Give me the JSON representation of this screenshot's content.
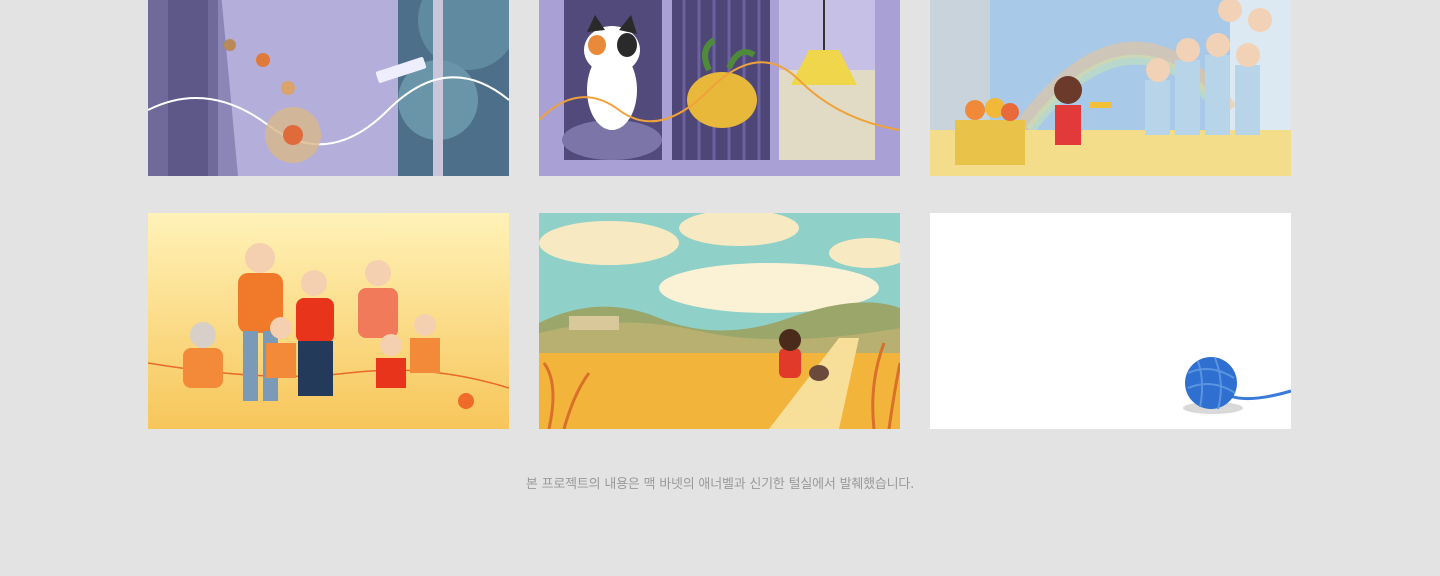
{
  "gallery": {
    "cards": [
      {
        "name": "illustration-town-street",
        "scene": "bird's-eye street with children and yarn line"
      },
      {
        "name": "illustration-cat-window",
        "scene": "calico cat, potted plant, hanging lamp on purple"
      },
      {
        "name": "illustration-rainbow-gift",
        "scene": "girl handing yarn gift to children under rainbow"
      },
      {
        "name": "illustration-family-sweaters",
        "scene": "family in orange knit sweaters"
      },
      {
        "name": "illustration-autumn-field",
        "scene": "girl and dog walking through golden field"
      },
      {
        "name": "illustration-blue-yarn",
        "scene": "blue ball of yarn on white"
      }
    ]
  },
  "footer": {
    "caption": "본 프로젝트의 내용은 맥 바넷의 애너벨과 신기한 털실에서 발췌했습니다."
  },
  "colors": {
    "background": "#e3e3e3",
    "caption_text": "#9a9a9a",
    "purple": "#a9a0d6",
    "orange": "#f08a2c",
    "yarn_blue": "#2e6fd0"
  }
}
